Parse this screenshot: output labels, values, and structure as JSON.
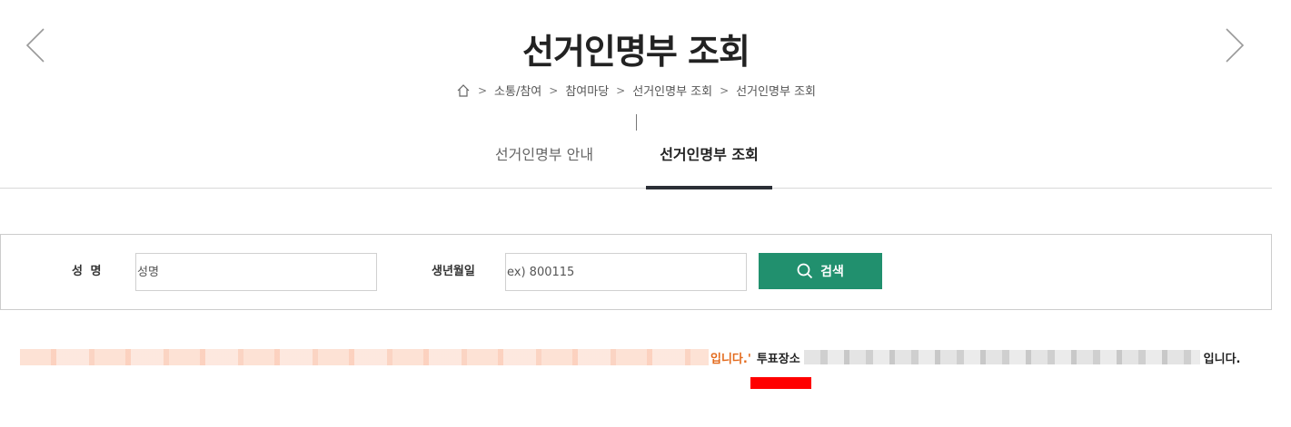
{
  "header": {
    "title": "선거인명부 조회"
  },
  "breadcrumb": {
    "home_icon": "home-icon",
    "items": [
      "소통/참여",
      "참여마당",
      "선거인명부 조회",
      "선거인명부 조회"
    ]
  },
  "tabs": [
    {
      "label": "선거인명부 안내",
      "active": false
    },
    {
      "label": "선거인명부 조회",
      "active": true
    }
  ],
  "search_form": {
    "name_label": "성 명",
    "name_placeholder": "성명",
    "birth_label": "생년월일",
    "birth_placeholder": "ex) 800115",
    "search_button": "검색"
  },
  "result": {
    "quote_end": "입니다.'",
    "vote_place_label": "투표장소",
    "suffix": "입니다."
  },
  "colors": {
    "accent_green": "#21906e",
    "result_orange": "#e36a1c",
    "tab_underline": "#2b2f36",
    "red_mark": "#ff0000"
  }
}
